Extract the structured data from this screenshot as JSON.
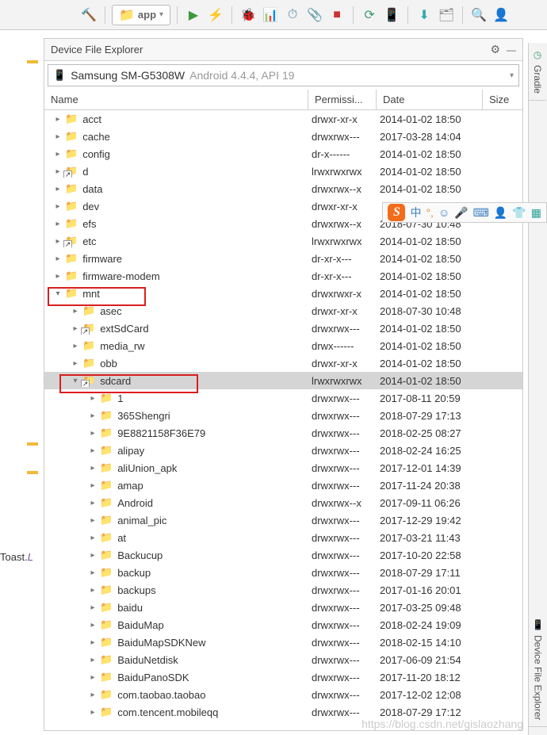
{
  "toolbar": {
    "app_label": "app"
  },
  "panel": {
    "title": "Device File Explorer"
  },
  "device": {
    "name": "Samsung SM-G5308W",
    "info": "Android 4.4.4, API 19"
  },
  "columns": {
    "name": "Name",
    "perm": "Permissi...",
    "date": "Date",
    "size": "Size"
  },
  "tree": [
    {
      "d": 0,
      "ex": false,
      "sc": false,
      "name": "acct",
      "perm": "drwxr-xr-x",
      "date": "2014-01-02 18:50"
    },
    {
      "d": 0,
      "ex": false,
      "sc": false,
      "name": "cache",
      "perm": "drwxrwx---",
      "date": "2017-03-28 14:04"
    },
    {
      "d": 0,
      "ex": false,
      "sc": false,
      "name": "config",
      "perm": "dr-x------",
      "date": "2014-01-02 18:50"
    },
    {
      "d": 0,
      "ex": false,
      "sc": true,
      "name": "d",
      "perm": "lrwxrwxrwx",
      "date": "2014-01-02 18:50"
    },
    {
      "d": 0,
      "ex": false,
      "sc": false,
      "name": "data",
      "perm": "drwxrwx--x",
      "date": "2014-01-02 18:50"
    },
    {
      "d": 0,
      "ex": false,
      "sc": false,
      "name": "dev",
      "perm": "drwxr-xr-x",
      "date": ""
    },
    {
      "d": 0,
      "ex": false,
      "sc": false,
      "name": "efs",
      "perm": "drwxrwx--x",
      "date": "2018-07-30 10:48"
    },
    {
      "d": 0,
      "ex": false,
      "sc": true,
      "name": "etc",
      "perm": "lrwxrwxrwx",
      "date": "2014-01-02 18:50"
    },
    {
      "d": 0,
      "ex": false,
      "sc": false,
      "name": "firmware",
      "perm": "dr-xr-x---",
      "date": "2014-01-02 18:50"
    },
    {
      "d": 0,
      "ex": false,
      "sc": false,
      "name": "firmware-modem",
      "perm": "dr-xr-x---",
      "date": "2014-01-02 18:50"
    },
    {
      "d": 0,
      "ex": true,
      "sc": false,
      "name": "mnt",
      "perm": "drwxrwxr-x",
      "date": "2014-01-02 18:50"
    },
    {
      "d": 1,
      "ex": false,
      "sc": false,
      "name": "asec",
      "perm": "drwxr-xr-x",
      "date": "2018-07-30 10:48"
    },
    {
      "d": 1,
      "ex": false,
      "sc": true,
      "name": "extSdCard",
      "perm": "drwxrwx---",
      "date": "2014-01-02 18:50"
    },
    {
      "d": 1,
      "ex": false,
      "sc": false,
      "name": "media_rw",
      "perm": "drwx------",
      "date": "2014-01-02 18:50"
    },
    {
      "d": 1,
      "ex": false,
      "sc": false,
      "name": "obb",
      "perm": "drwxr-xr-x",
      "date": "2014-01-02 18:50"
    },
    {
      "d": 1,
      "ex": true,
      "sc": true,
      "name": "sdcard",
      "perm": "lrwxrwxrwx",
      "date": "2014-01-02 18:50",
      "sel": true
    },
    {
      "d": 2,
      "ex": false,
      "sc": false,
      "name": "1",
      "perm": "drwxrwx---",
      "date": "2017-08-11 20:59"
    },
    {
      "d": 2,
      "ex": false,
      "sc": false,
      "name": "365Shengri",
      "perm": "drwxrwx---",
      "date": "2018-07-29 17:13"
    },
    {
      "d": 2,
      "ex": false,
      "sc": false,
      "name": "9E8821158F36E79",
      "perm": "drwxrwx---",
      "date": "2018-02-25 08:27"
    },
    {
      "d": 2,
      "ex": false,
      "sc": false,
      "name": "alipay",
      "perm": "drwxrwx---",
      "date": "2018-02-24 16:25"
    },
    {
      "d": 2,
      "ex": false,
      "sc": false,
      "name": "aliUnion_apk",
      "perm": "drwxrwx---",
      "date": "2017-12-01 14:39"
    },
    {
      "d": 2,
      "ex": false,
      "sc": false,
      "name": "amap",
      "perm": "drwxrwx---",
      "date": "2017-11-24 20:38"
    },
    {
      "d": 2,
      "ex": false,
      "sc": false,
      "name": "Android",
      "perm": "drwxrwx--x",
      "date": "2017-09-11 06:26"
    },
    {
      "d": 2,
      "ex": false,
      "sc": false,
      "name": "animal_pic",
      "perm": "drwxrwx---",
      "date": "2017-12-29 19:42"
    },
    {
      "d": 2,
      "ex": false,
      "sc": false,
      "name": "at",
      "perm": "drwxrwx---",
      "date": "2017-03-21 11:43"
    },
    {
      "d": 2,
      "ex": false,
      "sc": false,
      "name": "Backucup",
      "perm": "drwxrwx---",
      "date": "2017-10-20 22:58"
    },
    {
      "d": 2,
      "ex": false,
      "sc": false,
      "name": "backup",
      "perm": "drwxrwx---",
      "date": "2018-07-29 17:11"
    },
    {
      "d": 2,
      "ex": false,
      "sc": false,
      "name": "backups",
      "perm": "drwxrwx---",
      "date": "2017-01-16 20:01"
    },
    {
      "d": 2,
      "ex": false,
      "sc": false,
      "name": "baidu",
      "perm": "drwxrwx---",
      "date": "2017-03-25 09:48"
    },
    {
      "d": 2,
      "ex": false,
      "sc": false,
      "name": "BaiduMap",
      "perm": "drwxrwx---",
      "date": "2018-02-24 19:09"
    },
    {
      "d": 2,
      "ex": false,
      "sc": false,
      "name": "BaiduMapSDKNew",
      "perm": "drwxrwx---",
      "date": "2018-02-15 14:10"
    },
    {
      "d": 2,
      "ex": false,
      "sc": false,
      "name": "BaiduNetdisk",
      "perm": "drwxrwx---",
      "date": "2017-06-09 21:54"
    },
    {
      "d": 2,
      "ex": false,
      "sc": false,
      "name": "BaiduPanoSDK",
      "perm": "drwxrwx---",
      "date": "2017-11-20 18:12"
    },
    {
      "d": 2,
      "ex": false,
      "sc": false,
      "name": "com.taobao.taobao",
      "perm": "drwxrwx---",
      "date": "2017-12-02 12:08"
    },
    {
      "d": 2,
      "ex": false,
      "sc": false,
      "name": "com.tencent.mobileqq",
      "perm": "drwxrwx---",
      "date": "2018-07-29 17:12"
    }
  ],
  "right_tabs": {
    "gradle": "Gradle",
    "dfe": "Device File Explorer"
  },
  "toast": {
    "cls": "Toast",
    "m": "L"
  },
  "watermark": "https://blog.csdn.net/gislaozhang"
}
